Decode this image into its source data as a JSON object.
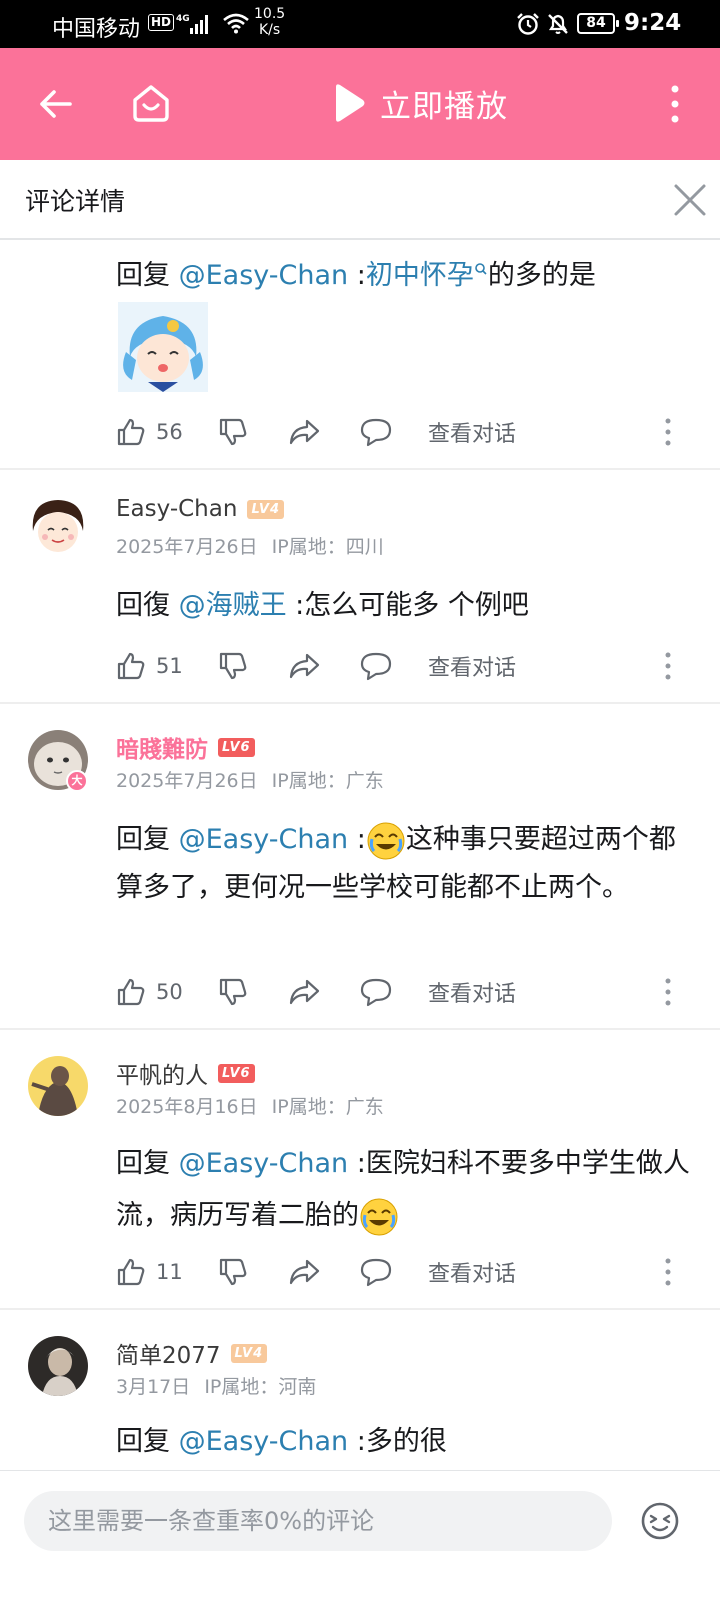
{
  "status_bar": {
    "carrier": "中国移动",
    "hd": "HD",
    "network": "4G",
    "speed_value": "10.5",
    "speed_unit": "K/s",
    "battery": "84",
    "time": "9:24"
  },
  "topbar": {
    "play_label": "立即播放"
  },
  "header": {
    "title": "评论详情"
  },
  "comments": [
    {
      "reply_prefix": "回复 ",
      "mention": "@Easy-Chan",
      "colon": " :",
      "link_text": "初中怀孕",
      "text": "的多的是",
      "likes": "56",
      "view_dialog": "查看对话"
    },
    {
      "username": "Easy-Chan",
      "level": "LV4",
      "date": "2025年7月26日",
      "ip": "IP属地：四川",
      "reply_prefix": "回復 ",
      "mention": "@海贼王",
      "colon": " :",
      "text": "怎么可能多 个例吧",
      "likes": "51",
      "view_dialog": "查看对话"
    },
    {
      "username": "暗賤難防",
      "level": "LV6",
      "badge": "大",
      "date": "2025年7月26日",
      "ip": "IP属地：广东",
      "reply_prefix": "回复 ",
      "mention": "@Easy-Chan",
      "colon": " :",
      "text": "这种事只要超过两个都算多了，更何况一些学校可能都不止两个。",
      "likes": "50",
      "view_dialog": "查看对话"
    },
    {
      "username": "平帆的人",
      "level": "LV6",
      "date": "2025年8月16日",
      "ip": "IP属地：广东",
      "reply_prefix": "回复 ",
      "mention": "@Easy-Chan",
      "colon": " :",
      "text": "医院妇科不要多中学生做人流，病历写着二胎的",
      "likes": "11",
      "view_dialog": "查看对话"
    },
    {
      "username": "简单2077",
      "level": "LV4",
      "date": "3月17日",
      "ip": "IP属地：河南",
      "reply_prefix": "回复 ",
      "mention": "@Easy-Chan",
      "colon": " :",
      "text": "多的很"
    }
  ],
  "bottom": {
    "placeholder": "这里需要一条查重率0%的评论"
  },
  "colors": {
    "brand_pink": "#fb7299",
    "mention_blue": "#2c7fb0",
    "lv4": "#f8c99c",
    "lv6": "#f25d5d"
  },
  "icons": [
    "back-arrow-icon",
    "home-icon",
    "play-icon",
    "more-vertical-icon",
    "close-icon",
    "thumb-up-icon",
    "thumb-down-icon",
    "share-icon",
    "comment-bubble-icon",
    "emoji-icon",
    "search-icon"
  ]
}
